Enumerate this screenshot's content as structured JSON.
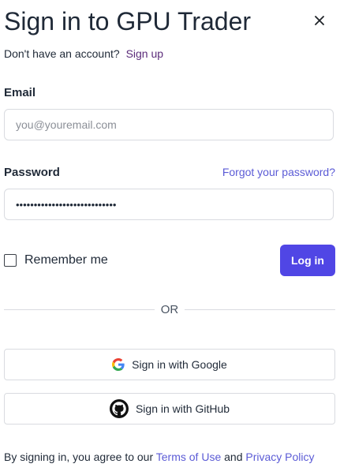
{
  "header": {
    "title": "Sign in to GPU Trader",
    "close_icon": "close-icon"
  },
  "signup": {
    "prompt": "Don't have an account?",
    "link": "Sign up"
  },
  "form": {
    "email_label": "Email",
    "email_placeholder": "you@youremail.com",
    "email_value": "",
    "password_label": "Password",
    "forgot_link": "Forgot your password?",
    "password_value": "••••••••••••••••••••••••••••",
    "remember_label": "Remember me",
    "remember_checked": false,
    "login_button": "Log in"
  },
  "divider": {
    "text": "OR"
  },
  "oauth": {
    "google": {
      "label": "Sign in with Google",
      "icon": "google-icon"
    },
    "github": {
      "label": "Sign in with GitHub",
      "icon": "github-icon"
    }
  },
  "footer": {
    "prefix": "By signing in, you agree to our",
    "terms": "Terms of Use",
    "and": "and",
    "privacy": "Privacy Policy"
  },
  "colors": {
    "primary": "#5046e5",
    "link": "#5b5bd6",
    "signup_link": "#5b2b7a",
    "border": "#d9dbe0"
  }
}
